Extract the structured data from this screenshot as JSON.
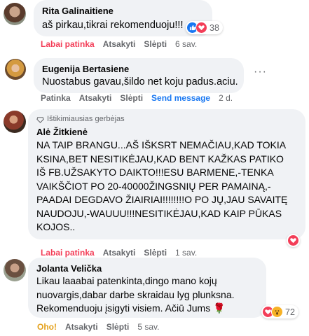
{
  "colors": {
    "love_red": "#f33e58",
    "haha_yellow": "#f7b125",
    "link_blue": "#1877f2",
    "like_blue": "#1877f2",
    "meta_gray": "#65676b",
    "bubble_gray": "#f0f2f5"
  },
  "comments": [
    {
      "author": "Rita Galinaitiene",
      "text": "aš pirkau,tikrai rekomenduoju!!!",
      "actions": {
        "like": "Labai patinka",
        "reply": "Atsakyti",
        "hide": "Slėpti",
        "time": "6 sav."
      },
      "reactions": {
        "icons": [
          "like-icon",
          "love-icon"
        ],
        "count": "38"
      }
    },
    {
      "author": "Eugenija Bertasiene",
      "text": "Nuostabus gavau,šildo net koju padus.aciu.",
      "more": "···",
      "actions": {
        "like": "Patinka",
        "reply": "Atsakyti",
        "hide": "Slėpti",
        "send": "Send message",
        "time": "2 d."
      }
    },
    {
      "badge": "Ištikimiausias gerbėjas",
      "author": "Alė Žitkienė",
      "lines": [
        "NA TAIP BRANGU...AŠ IŠKSRT NEMAČIAU,KAD TOKIA",
        "KSINA,BET NESITIKĖJAU,KAD BENT KAŽKAS PATIKO",
        "IŠ FB.UŽSAKYTO DAIKTO!!!ESU BARMENE,-TENKA",
        "VAIKŠČIOT PO 20-40000ŽINGSNIŲ PER PAMAINĄ,-",
        "PAADAI DEGDAVO ŽIAIRIAI!!!!!!!!O PO JŲ,JAU SAVAITĘ",
        "NAUDOJU,-WAUUU!!!NESITIKĖJAU,KAD KAIP PŪKAS",
        "KOJOS.."
      ],
      "actions": {
        "like": "Labai patinka",
        "reply": "Atsakyti",
        "hide": "Slėpti",
        "time": "1 sav."
      },
      "reactions": {
        "icons": [
          "love-icon"
        ]
      }
    },
    {
      "author": "Jolanta Velička",
      "lines": [
        "Likau laaabai patenkinta,dingo mano kojų",
        "nuovargis,dabar darbe skraidau lyg plunksna.",
        "Rekomenduoju įsigyti visiem. Ačiū Jums 🌹"
      ],
      "actions": {
        "like": "Oho!",
        "reply": "Atsakyti",
        "hide": "Slėpti",
        "time": "5 sav."
      },
      "reactions": {
        "icons": [
          "love-icon",
          "wow-icon"
        ],
        "count": "72"
      }
    }
  ]
}
